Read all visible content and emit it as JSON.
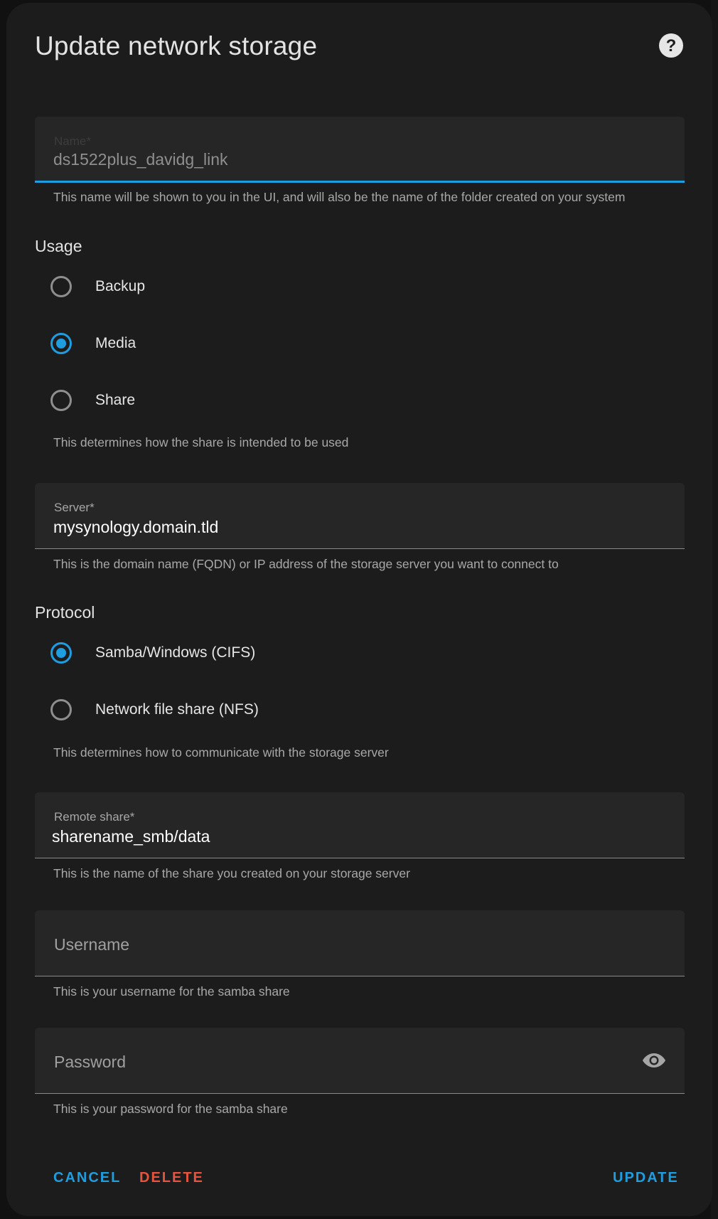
{
  "dialog": {
    "title": "Update network storage"
  },
  "icons": {
    "help": "help-circle-icon",
    "visibility": "eye-icon"
  },
  "colors": {
    "accent": "#1e9de0",
    "danger": "#e8533d",
    "surface": "#1c1c1c",
    "field": "#262626"
  },
  "name_field": {
    "label": "Name*",
    "value": "ds1522plus_davidg_link",
    "helper": "This name will be shown to you in the UI, and will also be the name of the folder created on your system"
  },
  "usage": {
    "title": "Usage",
    "options": [
      {
        "label": "Backup",
        "checked": false
      },
      {
        "label": "Media",
        "checked": true
      },
      {
        "label": "Share",
        "checked": false
      }
    ],
    "helper": "This determines how the share is intended to be used"
  },
  "server_field": {
    "label": "Server*",
    "value": "mysynology.domain.tld",
    "helper": "This is the domain name (FQDN) or IP address of the storage server you want to connect to"
  },
  "protocol": {
    "title": "Protocol",
    "options": [
      {
        "label": "Samba/Windows (CIFS)",
        "checked": true
      },
      {
        "label": "Network file share (NFS)",
        "checked": false
      }
    ],
    "helper": "This determines how to communicate with the storage server"
  },
  "remote_share_field": {
    "label": "Remote share*",
    "value": "sharename_smb/data",
    "helper": "This is the name of the share you created on your storage server"
  },
  "username_field": {
    "label": "Username",
    "value": "",
    "helper": "This is your username for the samba share"
  },
  "password_field": {
    "label": "Password",
    "value": "",
    "helper": "This is your password for the samba share"
  },
  "actions": {
    "cancel": "CANCEL",
    "delete": "DELETE",
    "update": "UPDATE"
  }
}
